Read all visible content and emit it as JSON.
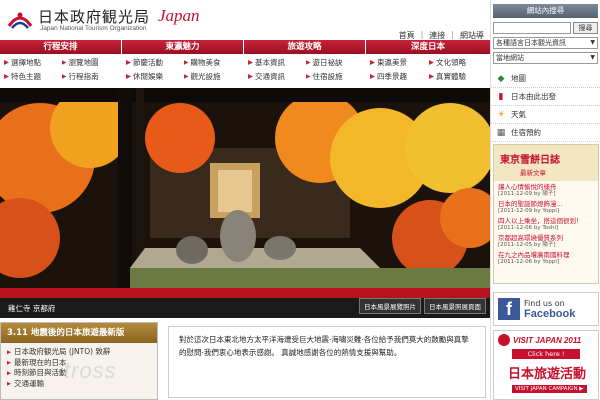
{
  "header": {
    "title": "日本政府観光局",
    "subtitle": "Japan National Tourism Organization",
    "japan": "Japan",
    "links": [
      "首頁",
      "連接",
      "網站導"
    ]
  },
  "nav": [
    {
      "head": "行程安排",
      "items": [
        "選擇地點",
        "瀏覽地圖",
        "特色主題",
        "行程指南"
      ]
    },
    {
      "head": "東瀛魅力",
      "items": [
        "節慶活動",
        "購物美食",
        "休閒娛樂",
        "觀光設施"
      ]
    },
    {
      "head": "旅遊攻略",
      "items": [
        "基本資訊",
        "遊日祕訣",
        "交通資訊",
        "住宿設施"
      ]
    },
    {
      "head": "深度日本",
      "items": [
        "東瀛美景",
        "文化領略",
        "四季景趣",
        "真實體驗"
      ]
    }
  ],
  "hero": {
    "caption": "雞仁寺 京都府",
    "btn1": "日本風景展覽照片",
    "btn2": "日本風景照展頁面"
  },
  "news": {
    "head": "3.11 地震後的日本旅遊最新版",
    "items": [
      "日本政府観光局 (JNTO) 致辭",
      "最新現在的日本",
      "時刻節目與活動",
      "交通運輸"
    ]
  },
  "message": {
    "text": "對於這次日本東北地方太平洋海遭受巨大地震·海嘯災難·各位給予我們莫大的鼓勵與真摯的慰問·我們衷心地表示感謝。 真誠地感謝各位的熱情支援與幫助。"
  },
  "watermark": "tross",
  "sidebar": {
    "head": "網站內搜尋",
    "search_btn": "搜尋",
    "select1": "各種語言日本觀光資訊",
    "select2": "當地網站",
    "links": [
      {
        "icon": "map-icon",
        "label": "地圖"
      },
      {
        "icon": "train-icon",
        "label": "日本由此出發"
      },
      {
        "icon": "weather-icon",
        "label": "天氣"
      },
      {
        "icon": "hotel-icon",
        "label": "住宿預約"
      }
    ],
    "snow": {
      "title": "東京雪餅日誌",
      "sub": "最新文章",
      "items": [
        {
          "t": "讓人心情愉悅的樣舟",
          "d": "[2011-12-09 by 陽子]"
        },
        {
          "t": "日本的聖誕節燈飾漫...",
          "d": "[2011-12-09 by Yoppi]"
        },
        {
          "t": "四人以上乘坐，搭這個很划！",
          "d": "[2011-12-06 by Toshi]"
        },
        {
          "t": "京都超高環繞優質系列",
          "d": "[2011-12-05 by 陽子]"
        },
        {
          "t": "在九之內品嚐廣南國料理",
          "d": "[2011-12-06 by Yoppi]"
        }
      ]
    },
    "fb": {
      "l1": "Find us on",
      "l2": "Facebook"
    },
    "vj": {
      "top": "VISIT JAPAN 2011",
      "click": "Click here !",
      "cn": "日本旅遊活動",
      "en": "VISIT JAPAN CAMPAIGN ▶"
    }
  },
  "colors": {
    "accent": "#c8102e",
    "nav": "#c8243a"
  }
}
